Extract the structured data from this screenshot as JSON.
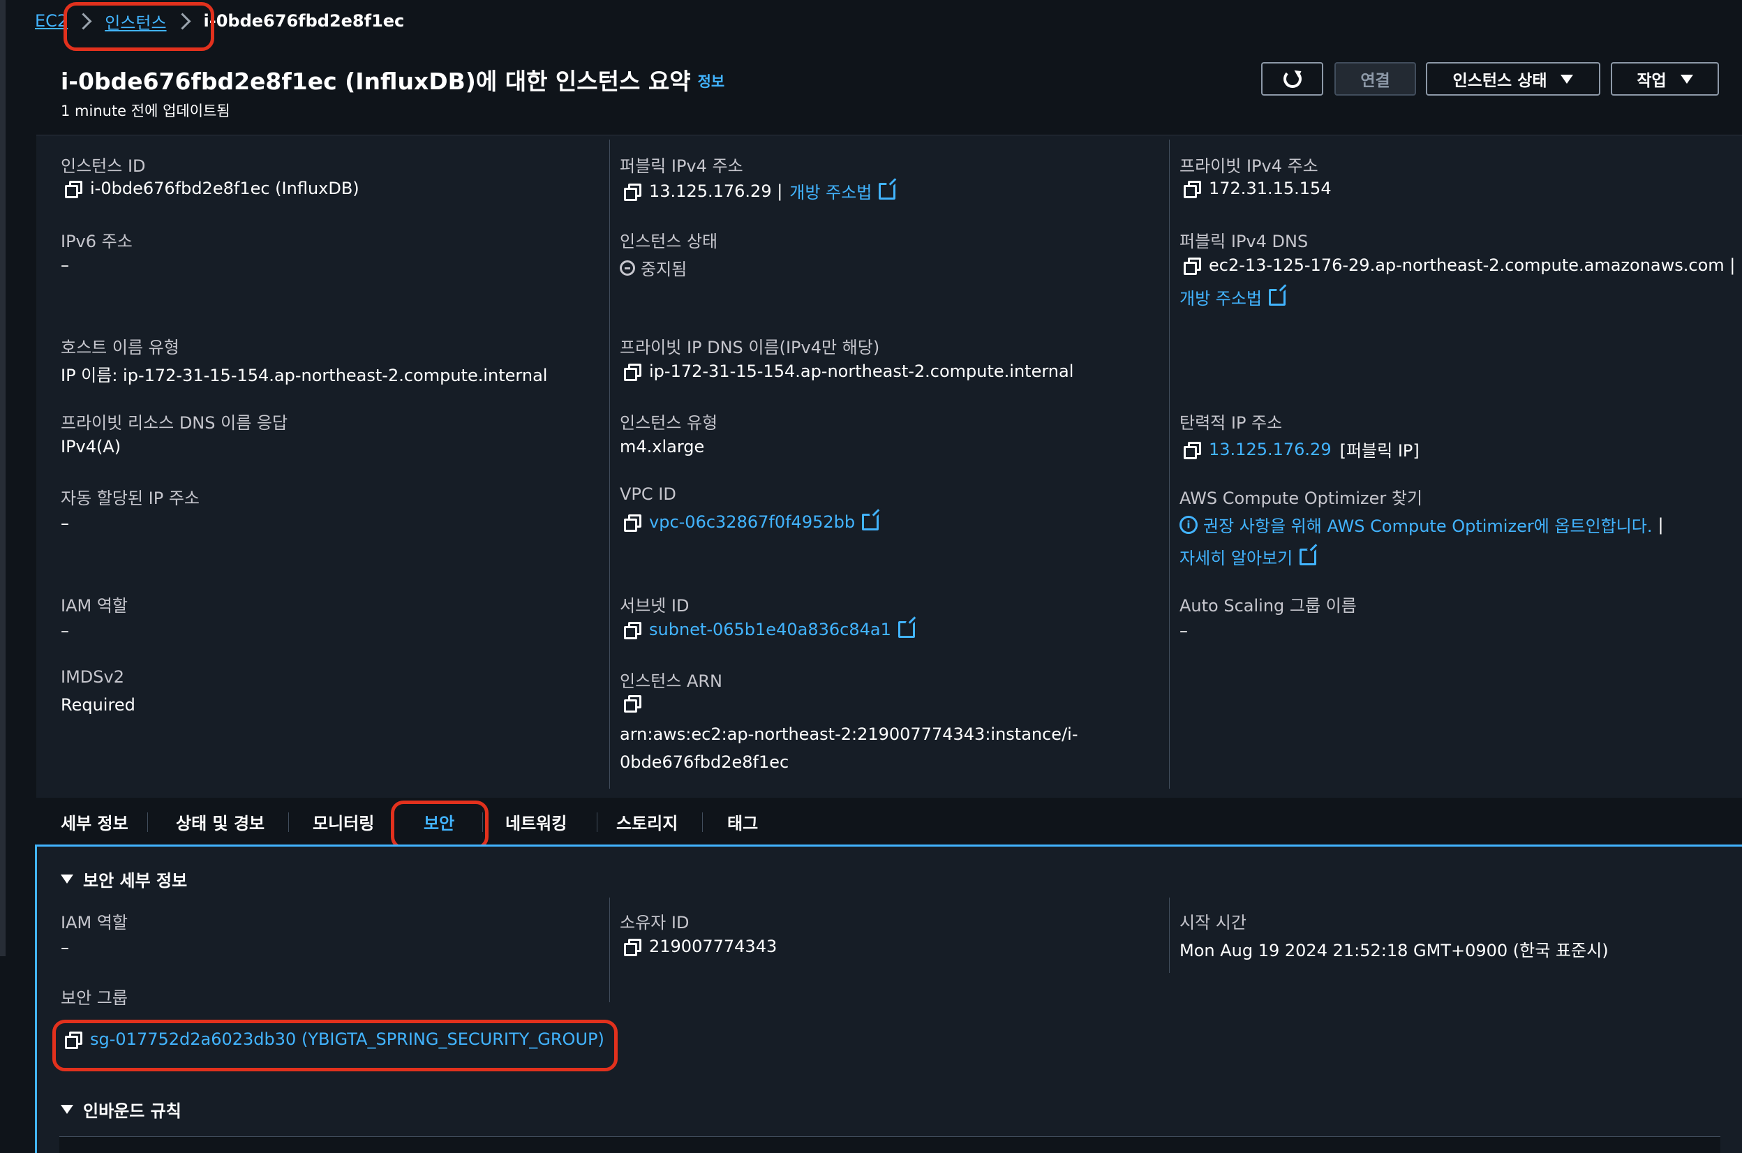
{
  "breadcrumb": {
    "root": "EC2",
    "instances": "인스턴스",
    "current": "i-0bde676fbd2e8f1ec"
  },
  "header": {
    "title": "i-0bde676fbd2e8f1ec (InfluxDB)에 대한 인스턴스 요약",
    "info_link": "정보",
    "updated": "1 minute 전에 업데이트됨",
    "refresh_icon": "refresh-icon",
    "connect_label": "연결",
    "state_label": "인스턴스 상태",
    "actions_label": "작업"
  },
  "summary": {
    "instance_id": {
      "label": "인스턴스 ID",
      "value": "i-0bde676fbd2e8f1ec (InfluxDB)"
    },
    "public_ipv4": {
      "label": "퍼블릭 IPv4 주소",
      "value": "13.125.176.29 |",
      "link": "개방 주소법"
    },
    "private_ipv4": {
      "label": "프라이빗 IPv4 주소",
      "value": "172.31.15.154"
    },
    "ipv6": {
      "label": "IPv6 주소",
      "value": "–"
    },
    "instance_state": {
      "label": "인스턴스 상태",
      "value": "중지됨"
    },
    "public_dns": {
      "label": "퍼블릭 IPv4 DNS",
      "value": "ec2-13-125-176-29.ap-northeast-2.compute.amazonaws.com |",
      "link": "개방 주소법"
    },
    "hostname_type": {
      "label": "호스트 이름 유형",
      "value": "IP 이름: ip-172-31-15-154.ap-northeast-2.compute.internal"
    },
    "private_dns": {
      "label": "프라이빗 IP DNS 이름(IPv4만 해당)",
      "value": "ip-172-31-15-154.ap-northeast-2.compute.internal"
    },
    "private_resource_dns": {
      "label": "프라이빗 리소스 DNS 이름 응답",
      "value": "IPv4(A)"
    },
    "instance_type": {
      "label": "인스턴스 유형",
      "value": "m4.xlarge"
    },
    "elastic_ip": {
      "label": "탄력적 IP 주소",
      "value": "13.125.176.29",
      "suffix": "[퍼블릭 IP]"
    },
    "auto_ip": {
      "label": "자동 할당된 IP 주소",
      "value": "–"
    },
    "vpc_id": {
      "label": "VPC ID",
      "value": "vpc-06c32867f0f4952bb"
    },
    "optimizer": {
      "label": "AWS Compute Optimizer 찾기",
      "value": "권장 사항을 위해 AWS Compute Optimizer에 옵트인합니다.",
      "sep": "|",
      "link": "자세히 알아보기"
    },
    "iam_role": {
      "label": "IAM 역할",
      "value": "–"
    },
    "subnet_id": {
      "label": "서브넷 ID",
      "value": "subnet-065b1e40a836c84a1"
    },
    "asg_name": {
      "label": "Auto Scaling 그룹 이름",
      "value": "–"
    },
    "imdsv2": {
      "label": "IMDSv2",
      "value": "Required"
    },
    "arn": {
      "label": "인스턴스 ARN",
      "line1": "arn:aws:ec2:ap-northeast-2:219007774343:instance/i-",
      "line2": "0bde676fbd2e8f1ec"
    }
  },
  "tabs": [
    "세부 정보",
    "상태 및 경보",
    "모니터링",
    "보안",
    "네트워킹",
    "스토리지",
    "태그"
  ],
  "security": {
    "section_title": "보안 세부 정보",
    "iam_role": {
      "label": "IAM 역할",
      "value": "–"
    },
    "owner_id": {
      "label": "소유자 ID",
      "value": "219007774343"
    },
    "launch_time": {
      "label": "시작 시간",
      "value": "Mon Aug 19 2024 21:52:18 GMT+0900 (한국 표준시)"
    },
    "security_group": {
      "label": "보안 그룹",
      "value": "sg-017752d2a6023db30 (YBIGTA_SPRING_SECURITY_GROUP)"
    },
    "inbound_title": "인바운드 규칙"
  },
  "colors": {
    "link": "#42b4ff",
    "highlight": "#e2311d",
    "background": "#0f141a",
    "panel": "#161d26"
  }
}
